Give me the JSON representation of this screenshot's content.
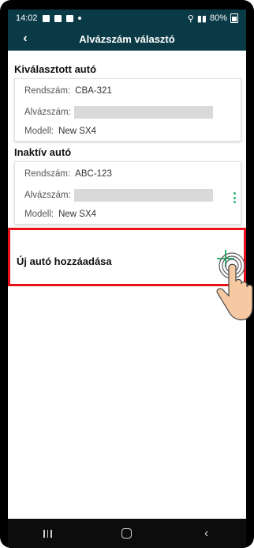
{
  "status_bar": {
    "time": "14:02",
    "battery": "80%"
  },
  "app_bar": {
    "title": "Alvázszám választó",
    "back_icon": "chevron-left-icon"
  },
  "selected": {
    "title": "Kiválasztott autó",
    "plate_label": "Rendszám:",
    "plate_value": "CBA-321",
    "vin_label": "Alvázszám:",
    "model_label": "Modell:",
    "model_value": "New SX4"
  },
  "inactive": {
    "title": "Inaktív autó",
    "plate_label": "Rendszám:",
    "plate_value": "ABC-123",
    "vin_label": "Alvázszám:",
    "model_label": "Modell:",
    "model_value": "New SX4",
    "menu_icon": "kebab-menu-icon"
  },
  "add_car": {
    "label": "Új autó hozzáadása",
    "icon": "plus-icon"
  },
  "colors": {
    "header": "#0b3a47",
    "accent": "#2bb673",
    "highlight": "#e8101a"
  }
}
